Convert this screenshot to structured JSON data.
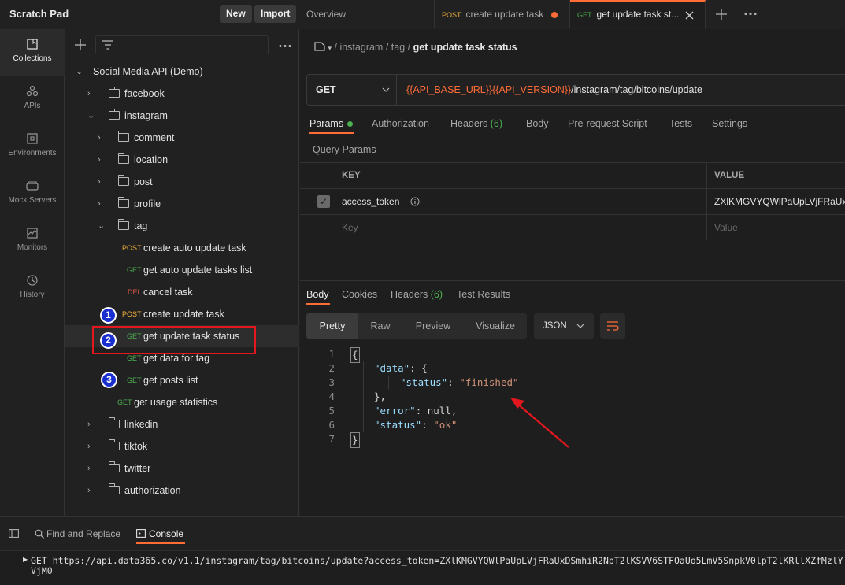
{
  "topbar": {
    "workspace_title": "Scratch Pad",
    "new_label": "New",
    "import_label": "Import",
    "tabs": [
      {
        "label": "Overview"
      },
      {
        "method": "POST",
        "label": "create update task",
        "unsaved": true
      },
      {
        "method": "GET",
        "label": "get update task st...",
        "active": true
      }
    ]
  },
  "rail": {
    "items": [
      {
        "label": "Collections",
        "icon": "collections-icon",
        "active": true
      },
      {
        "label": "APIs",
        "icon": "apis-icon"
      },
      {
        "label": "Environments",
        "icon": "environments-icon"
      },
      {
        "label": "Mock Servers",
        "icon": "mock-servers-icon"
      },
      {
        "label": "Monitors",
        "icon": "monitors-icon"
      },
      {
        "label": "History",
        "icon": "history-icon"
      }
    ]
  },
  "sidebar": {
    "collection_name": "Social Media API (Demo)",
    "tree": {
      "facebook": "facebook",
      "instagram": "instagram",
      "comment": "comment",
      "location": "location",
      "post": "post",
      "profile": "profile",
      "tag": "tag",
      "req1": {
        "method": "POST",
        "label": "create auto update task"
      },
      "req2": {
        "method": "GET",
        "label": "get auto update tasks list"
      },
      "req3": {
        "method": "DEL",
        "label": "cancel task"
      },
      "req4": {
        "method": "POST",
        "label": "create update task"
      },
      "req5": {
        "method": "GET",
        "label": "get update task status"
      },
      "req6": {
        "method": "GET",
        "label": "get data for tag"
      },
      "req7": {
        "method": "GET",
        "label": "get posts list"
      },
      "req8": {
        "method": "GET",
        "label": "get usage statistics"
      },
      "linkedin": "linkedin",
      "tiktok": "tiktok",
      "twitter": "twitter",
      "authorization": "authorization"
    },
    "annotations": [
      "1",
      "2",
      "3"
    ]
  },
  "request": {
    "breadcrumb": [
      "instagram",
      "tag"
    ],
    "title": "get update task status",
    "method": "GET",
    "url_var1": "{{API_BASE_URL}}",
    "url_var2": "{{API_VERSION}}",
    "url_path": "/instagram/tag/bitcoins/update",
    "tabs": {
      "params": "Params",
      "authorization": "Authorization",
      "headers": "Headers",
      "headers_count": "(6)",
      "body": "Body",
      "prerequest": "Pre-request Script",
      "tests": "Tests",
      "settings": "Settings"
    },
    "query_params_label": "Query Params",
    "table": {
      "key_header": "KEY",
      "value_header": "VALUE",
      "row_key": "access_token",
      "row_value": "ZXlKMGVYQWlPaUpLVjFRaUx",
      "key_placeholder": "Key",
      "value_placeholder": "Value"
    }
  },
  "response": {
    "tabs": {
      "body": "Body",
      "cookies": "Cookies",
      "headers": "Headers",
      "headers_count": "(6)",
      "test_results": "Test Results"
    },
    "views": {
      "pretty": "Pretty",
      "raw": "Raw",
      "preview": "Preview",
      "visualize": "Visualize"
    },
    "format": "JSON",
    "code": {
      "l1": "{",
      "l2k": "\"data\"",
      "l2r": ": {",
      "l3k": "\"status\"",
      "l3s": "\"finished\"",
      "l4": "},",
      "l5k": "\"error\"",
      "l5r": ": null,",
      "l6k": "\"status\"",
      "l6s": "\"ok\"",
      "l7": "}"
    },
    "line_numbers": [
      "1",
      "2",
      "3",
      "4",
      "5",
      "6",
      "7"
    ]
  },
  "console": {
    "find_replace": "Find and Replace",
    "console_label": "Console",
    "log": "GET https://api.data365.co/v1.1/instagram/tag/bitcoins/update?access_token=ZXlKMGVYQWlPaUpLVjFRaUxDSmhiR2NpT2lKSVV6STFOaUo5LmV5SnpkV0lpT2lKRllXZfMzlYVjM0"
  },
  "colors": {
    "accent": "#ff6c37",
    "get": "#4caf50",
    "post": "#f3b33d",
    "del": "#e2574c",
    "highlight": "#e3171e",
    "badge": "#1a2fd0"
  }
}
